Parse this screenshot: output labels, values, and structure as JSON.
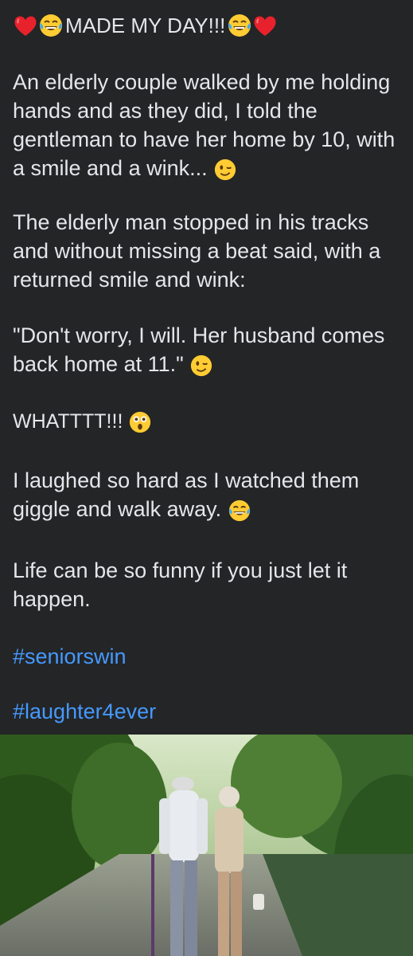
{
  "post": {
    "headline": "MADE MY DAY!!!",
    "paragraphs": [
      "An elderly couple walked by me holding hands and as they did, I told the gentleman to have her home by 10, with a smile and a wink...",
      "The elderly man stopped in his tracks and without missing a beat said, with a returned smile and wink:",
      "\"Don't worry, I will. Her husband comes back home at 11.\"",
      "WHATTTT!!!",
      "I laughed so hard as I watched them giggle and walk away.",
      "Life can be so funny if you just let it happen."
    ],
    "hashtags": [
      "#seniorswin",
      "#laughter4ever"
    ],
    "emojis": {
      "heart": "red-heart-icon",
      "laugh": "tears-of-joy-icon",
      "wink": "winking-face-icon",
      "shock": "astonished-face-icon"
    }
  },
  "colors": {
    "background": "#242526",
    "text": "#e4e6eb",
    "hashtag": "#4599ff"
  }
}
